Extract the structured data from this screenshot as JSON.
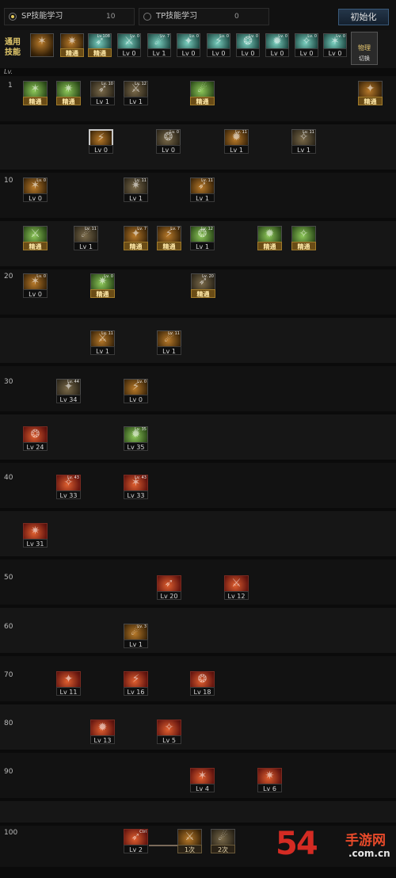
{
  "tabs": [
    {
      "label": "SP技能学习",
      "points": "10",
      "selected": true
    },
    {
      "label": "TP技能学习",
      "points": "0",
      "selected": false
    }
  ],
  "init_button": "初始化",
  "common_label": "通用技能",
  "lv_header": "Lv.",
  "swap_button": {
    "top": "物理",
    "label": "切换"
  },
  "level_markers": [
    "1",
    "10",
    "20",
    "30",
    "40",
    "50",
    "60",
    "70",
    "80",
    "90",
    "100"
  ],
  "common_skills": [
    {
      "icon": "skill-icon",
      "caption": "",
      "style": "orange",
      "mini": ""
    },
    {
      "icon": "skill-icon",
      "caption": "精通",
      "style": "orange",
      "mini": ""
    },
    {
      "icon": "skill-icon",
      "caption": "精通",
      "style": "teal",
      "mini": "Lv.108"
    },
    {
      "icon": "skill-icon",
      "caption": "Lv 0",
      "style": "teal",
      "mini": "Lv. 0"
    },
    {
      "icon": "skill-icon",
      "caption": "Lv 1",
      "style": "teal",
      "mini": "Lv. 7"
    },
    {
      "icon": "skill-icon",
      "caption": "Lv 0",
      "style": "teal",
      "mini": "Lv. 0"
    },
    {
      "icon": "skill-icon",
      "caption": "Lv 0",
      "style": "teal",
      "mini": "Lv. 0"
    },
    {
      "icon": "skill-icon",
      "caption": "Lv 0",
      "style": "teal",
      "mini": "Lv. 0"
    },
    {
      "icon": "skill-icon",
      "caption": "Lv 0",
      "style": "teal",
      "mini": "Lv. 0"
    },
    {
      "icon": "skill-icon",
      "caption": "Lv 0",
      "style": "teal",
      "mini": "Lv. 0"
    },
    {
      "icon": "skill-icon",
      "caption": "Lv 0",
      "style": "teal",
      "mini": "Lv. 0"
    }
  ],
  "skills": [
    {
      "caption": "精通",
      "style": "green",
      "mini": ""
    },
    {
      "caption": "精通",
      "style": "green",
      "mini": ""
    },
    {
      "caption": "Lv 1",
      "style": "dark",
      "mini": "Lv. 10"
    },
    {
      "caption": "Lv 1",
      "style": "dark",
      "mini": "Lv. 12"
    },
    {
      "caption": "精通",
      "style": "green",
      "mini": ""
    },
    {
      "caption": "精通",
      "style": "orange",
      "mini": ""
    },
    {
      "caption": "Lv 0",
      "style": "orange",
      "mini": ""
    },
    {
      "caption": "Lv 0",
      "style": "dark",
      "mini": "Lv. 0"
    },
    {
      "caption": "Lv 1",
      "style": "orange",
      "mini": "Lv. 11"
    },
    {
      "caption": "Lv 1",
      "style": "dark",
      "mini": "Lv. 11"
    },
    {
      "caption": "Lv 0",
      "style": "orange",
      "mini": "Lv. 0"
    },
    {
      "caption": "Lv 1",
      "style": "dark",
      "mini": "Lv. 11"
    },
    {
      "caption": "Lv 1",
      "style": "orange",
      "mini": "Lv. 11"
    },
    {
      "caption": "精通",
      "style": "green",
      "mini": ""
    },
    {
      "caption": "Lv 1",
      "style": "dark",
      "mini": "Lv. 11"
    },
    {
      "caption": "精通",
      "style": "orange",
      "mini": "Lv. 7"
    },
    {
      "caption": "精通",
      "style": "orange",
      "mini": "Lv. 7"
    },
    {
      "caption": "Lv 1",
      "style": "green",
      "mini": "Lv. 12"
    },
    {
      "caption": "精通",
      "style": "green",
      "mini": ""
    },
    {
      "caption": "精通",
      "style": "green",
      "mini": ""
    },
    {
      "caption": "Lv 0",
      "style": "orange",
      "mini": "Lv. 0"
    },
    {
      "caption": "精通",
      "style": "green",
      "mini": "Lv. 0"
    },
    {
      "caption": "精通",
      "style": "dark",
      "mini": "Lv. 20"
    },
    {
      "caption": "Lv 1",
      "style": "orange",
      "mini": "Lv. 11"
    },
    {
      "caption": "Lv 1",
      "style": "orange",
      "mini": "Lv. 11"
    },
    {
      "caption": "Lv 34",
      "style": "dark",
      "mini": "Lv. 44"
    },
    {
      "caption": "Lv 0",
      "style": "orange",
      "mini": "Lv. 0"
    },
    {
      "caption": "Lv 24",
      "style": "red",
      "mini": ""
    },
    {
      "caption": "Lv 35",
      "style": "green",
      "mini": "Lv. 35"
    },
    {
      "caption": "Lv 33",
      "style": "red",
      "mini": "Lv. 43"
    },
    {
      "caption": "Lv 33",
      "style": "red",
      "mini": "Lv. 43"
    },
    {
      "caption": "Lv 31",
      "style": "red",
      "mini": ""
    },
    {
      "caption": "Lv 20",
      "style": "red",
      "mini": ""
    },
    {
      "caption": "Lv 12",
      "style": "red",
      "mini": ""
    },
    {
      "caption": "Lv 1",
      "style": "orange",
      "mini": "Lv. 3"
    },
    {
      "caption": "Lv 11",
      "style": "red",
      "mini": ""
    },
    {
      "caption": "Lv 16",
      "style": "red",
      "mini": ""
    },
    {
      "caption": "Lv 18",
      "style": "red",
      "mini": ""
    },
    {
      "caption": "Lv 13",
      "style": "red",
      "mini": ""
    },
    {
      "caption": "Lv 5",
      "style": "red",
      "mini": ""
    },
    {
      "caption": "Lv 4",
      "style": "red",
      "mini": ""
    },
    {
      "caption": "Lv 6",
      "style": "red",
      "mini": ""
    },
    {
      "caption": "Lv 2",
      "style": "red",
      "mini": "Ctrl"
    },
    {
      "caption": "1次",
      "style": "orange",
      "mini": ""
    },
    {
      "caption": "2次",
      "style": "dark",
      "mini": ""
    }
  ],
  "watermark": {
    "big": "54",
    "cn": "手游网",
    "url": ".com.cn"
  }
}
